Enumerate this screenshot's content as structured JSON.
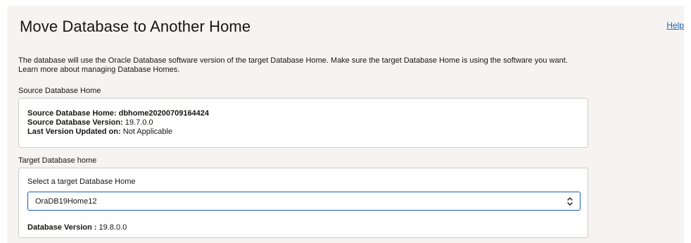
{
  "header": {
    "title": "Move Database to Another Home",
    "help_label": "Help"
  },
  "intro": {
    "text": "The database will use the Oracle Database software version of the target Database Home. Make sure the target Database Home is using the software you want.",
    "link": "Learn more about managing Database Homes."
  },
  "source": {
    "section_label": "Source Database Home",
    "home_label": "Source Database Home:",
    "home_value": "dbhome20200709164424",
    "version_label": "Source Database Version:",
    "version_value": "19.7.0.0",
    "updated_label": "Last Version Updated on:",
    "updated_value": "Not Applicable"
  },
  "target": {
    "section_label": "Target Database home",
    "select_label": "Select a target Database Home",
    "selected_value": "OraDB19Home12",
    "version_label": "Database Version :",
    "version_value": "19.8.0.0"
  },
  "icons": {
    "select_arrows": "up-down-chevron-icon"
  },
  "colors": {
    "panel_bg": "#f5f4f2",
    "link": "#1a5fb4",
    "focus_border": "#1a5fb4"
  }
}
